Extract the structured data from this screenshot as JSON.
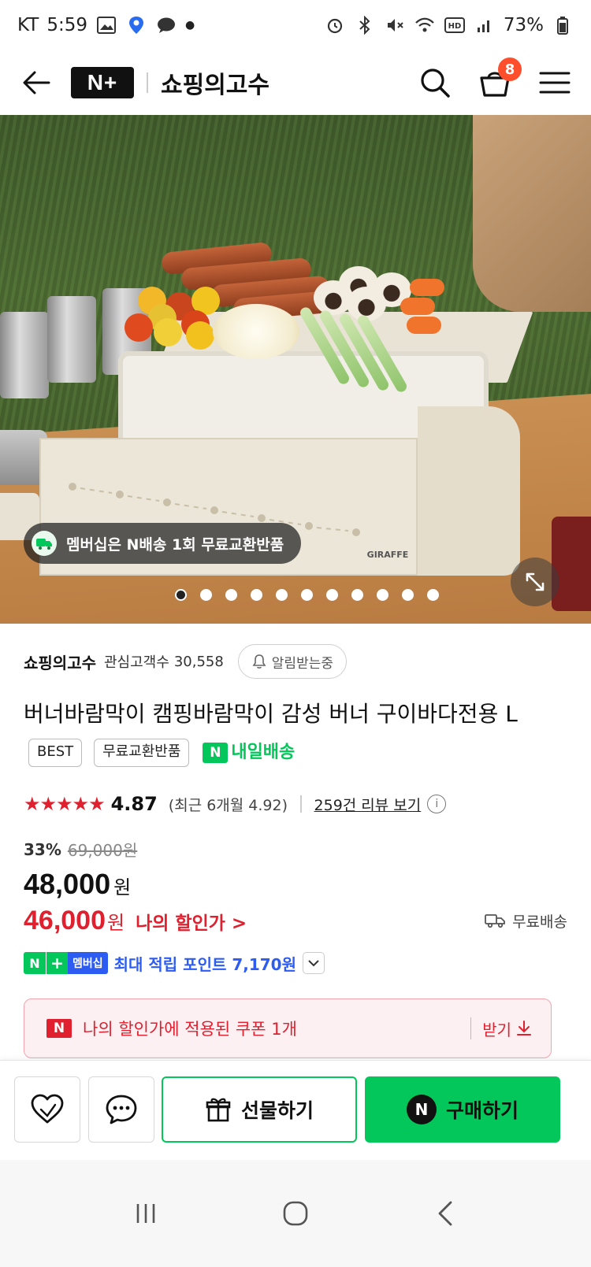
{
  "status_bar": {
    "carrier": "KT",
    "time": "5:59",
    "battery": "73%"
  },
  "header": {
    "brand": "N+",
    "store_title": "쇼핑의고수",
    "cart_count": "8"
  },
  "hero": {
    "promo_text": "멤버십은 N배송 1회 무료교환반품",
    "slide_count": 11,
    "active_slide": 1,
    "product_brand_print": "GIRAFFE"
  },
  "store": {
    "name": "쇼핑의고수",
    "follower_label": "관심고객수",
    "follower_count": "30,558",
    "alarm_label": "알림받는중"
  },
  "product": {
    "title": "버너바람막이 캠핑바람막이 감성 버너 구이바다전용 L",
    "tags": [
      "BEST",
      "무료교환반품"
    ],
    "delivery_badge": "N",
    "delivery_label": "내일배송"
  },
  "rating": {
    "stars": "★★★★★",
    "score": "4.87",
    "recent": "(최근 6개월 4.92)",
    "review_link": "259건 리뷰 보기",
    "info": "i"
  },
  "price": {
    "discount_rate": "33%",
    "original": "69,000원",
    "sale": "48,000",
    "won": "원",
    "my_price": "46,000",
    "my_price_label": "나의 할인가 >",
    "shipping": "무료배송"
  },
  "points": {
    "chip_n": "N",
    "chip_plus": "+",
    "chip_membership": "멤버십",
    "text": "최대 적립 포인트 7,170원"
  },
  "coupon": {
    "badge": "N",
    "text": "나의 할인가에 적용된 쿠폰 1개",
    "get_label": "받기"
  },
  "bottom_bar": {
    "gift_label": "선물하기",
    "buy_badge": "N",
    "buy_label": "구매하기"
  },
  "colors": {
    "naver_green": "#03c75a",
    "sale_red": "#e0202e",
    "point_blue": "#2c5cf2",
    "cart_badge": "#ff4e2b"
  }
}
